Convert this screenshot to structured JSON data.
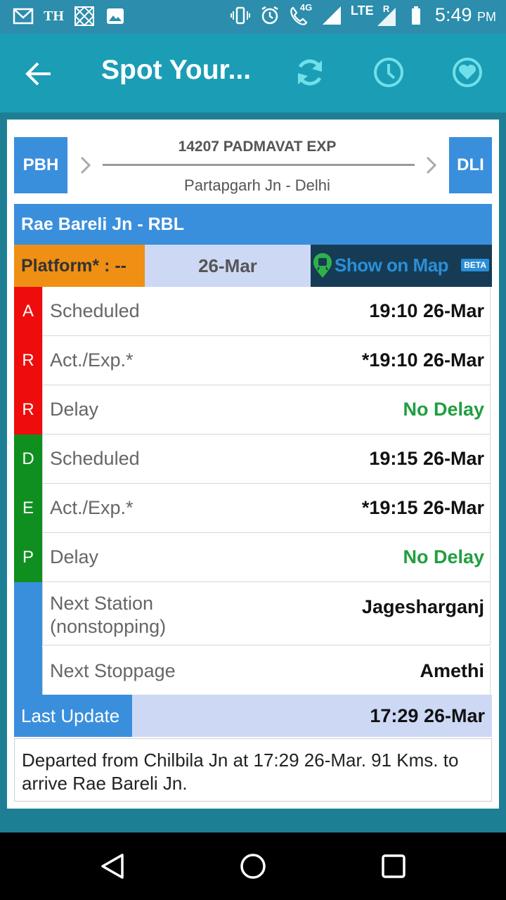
{
  "status_bar": {
    "carrier_badge": "TH",
    "network": "4G",
    "lte": "LTE",
    "roaming": "R",
    "time": "5:49",
    "ampm": "PM"
  },
  "app_bar": {
    "title": "Spot Your..."
  },
  "route": {
    "from_code": "PBH",
    "to_code": "DLI",
    "train": "14207 PADMAVAT EXP",
    "subtitle": "Partapgarh Jn - Delhi"
  },
  "station": {
    "title": "Rae Bareli Jn - RBL"
  },
  "info": {
    "platform": "Platform* : --",
    "date": "26-Mar",
    "map_label": "Show on Map",
    "beta": "BETA"
  },
  "arrival": {
    "side_letters": [
      "A",
      "R",
      "R"
    ],
    "rows": [
      {
        "label": "Scheduled",
        "value": "19:10 26-Mar"
      },
      {
        "label": "Act./Exp.*",
        "value": "*19:10 26-Mar"
      },
      {
        "label": "Delay",
        "value": "No Delay"
      }
    ]
  },
  "departure": {
    "side_letters": [
      "D",
      "E",
      "P"
    ],
    "rows": [
      {
        "label": "Scheduled",
        "value": "19:15 26-Mar"
      },
      {
        "label": "Act./Exp.*",
        "value": "*19:15 26-Mar"
      },
      {
        "label": "Delay",
        "value": "No Delay"
      }
    ]
  },
  "next": {
    "station_label_1": "Next Station",
    "station_label_2": "(nonstopping)",
    "station_value": "Jagesharganj",
    "stoppage_label": "Next Stoppage",
    "stoppage_value": "Amethi"
  },
  "last_update": {
    "label": "Last Update",
    "value": "17:29 26-Mar"
  },
  "message": "Departed from Chilbila Jn at 17:29 26-Mar. 91 Kms. to arrive Rae Bareli Jn.",
  "colors": {
    "arrival": "#ee0c0c",
    "departure": "#0f8f1f",
    "accent": "#3a8fdc",
    "platform": "#ef8f14",
    "delay_ok": "#1f9f3f"
  }
}
